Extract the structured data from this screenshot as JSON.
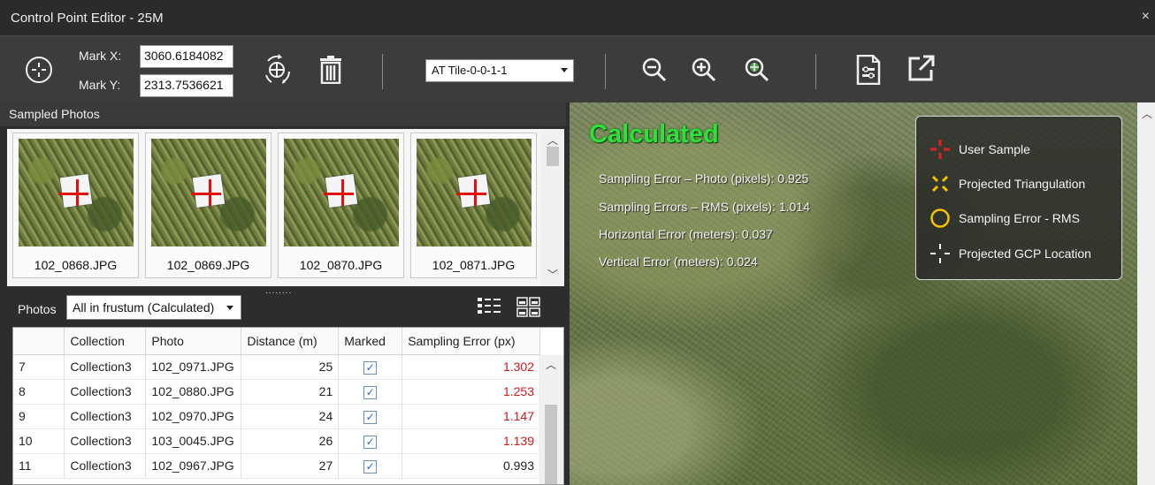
{
  "window": {
    "title": "Control Point Editor - 25M",
    "close_glyph": "×"
  },
  "toolbar": {
    "mark_x_label": "Mark X:",
    "mark_x_value": "3060.6184082",
    "mark_y_label": "Mark Y:",
    "mark_y_value": "2313.7536621",
    "tile_select_value": "AT Tile-0-0-1-1",
    "icons": [
      "crosshair-icon",
      "auto-mark-icon",
      "trash-icon",
      "zoom-out-icon",
      "zoom-in-icon",
      "zoom-to-point-icon",
      "report-icon",
      "open-external-icon"
    ]
  },
  "sampled": {
    "header": "Sampled Photos",
    "thumbnails": [
      {
        "caption": "102_0868.JPG"
      },
      {
        "caption": "102_0869.JPG"
      },
      {
        "caption": "102_0870.JPG"
      },
      {
        "caption": "102_0871.JPG"
      }
    ],
    "grip": "........"
  },
  "photos": {
    "label": "Photos",
    "filter_value": "All in frustum (Calculated)"
  },
  "table": {
    "columns": [
      "",
      "Collection",
      "Photo",
      "Distance (m)",
      "Marked",
      "Sampling Error (px)"
    ],
    "rows": [
      {
        "idx": "7",
        "collection": "Collection3",
        "photo": "102_0971.JPG",
        "distance": "25",
        "marked": true,
        "error": "1.302",
        "error_high": true
      },
      {
        "idx": "8",
        "collection": "Collection3",
        "photo": "102_0880.JPG",
        "distance": "21",
        "marked": true,
        "error": "1.253",
        "error_high": true
      },
      {
        "idx": "9",
        "collection": "Collection3",
        "photo": "102_0970.JPG",
        "distance": "24",
        "marked": true,
        "error": "1.147",
        "error_high": true
      },
      {
        "idx": "10",
        "collection": "Collection3",
        "photo": "103_0045.JPG",
        "distance": "26",
        "marked": true,
        "error": "1.139",
        "error_high": true
      },
      {
        "idx": "11",
        "collection": "Collection3",
        "photo": "102_0967.JPG",
        "distance": "27",
        "marked": true,
        "error": "0.993",
        "error_high": false
      }
    ]
  },
  "viewer": {
    "status": "Calculated",
    "lines": [
      "Sampling Error – Photo (pixels): 0.925",
      "Sampling Errors – RMS (pixels): 1.014",
      "Horizontal Error (meters): 0.037",
      "Vertical Error (meters): 0.024"
    ],
    "legend": [
      {
        "label": "User Sample",
        "color": "#e52020"
      },
      {
        "label": "Projected Triangulation",
        "color": "#f2c400"
      },
      {
        "label": "Sampling Error - RMS",
        "color": "#f2c400"
      },
      {
        "label": "Projected GCP Location",
        "color": "#ffffff"
      }
    ]
  },
  "colors": {
    "accent_green": "#2fe03a",
    "error_red": "#d01818",
    "check_blue": "#2a65c5"
  }
}
